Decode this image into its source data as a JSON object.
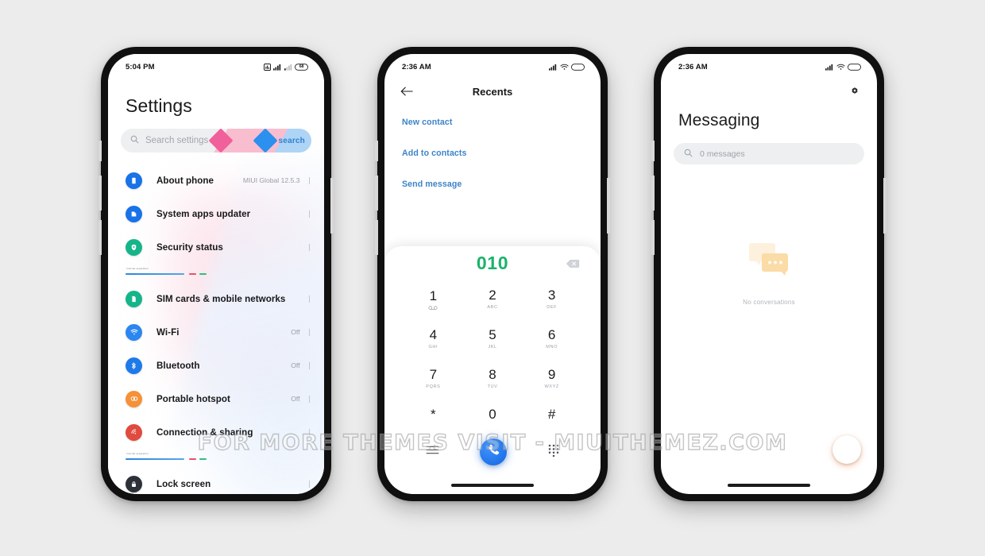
{
  "watermark": "FOR MORE THEMES VISIT - MIUITHEMEZ.COM",
  "phone_settings": {
    "status": {
      "time": "5:04 PM",
      "battery_level": "68"
    },
    "title": "Settings",
    "search": {
      "placeholder": "Search settings",
      "deco_label": "search",
      "icon": "search-icon"
    },
    "divider_label": "Internal separation",
    "items": [
      {
        "label": "About phone",
        "value": "MIUI Global 12.5.3",
        "icon": "phone-info-icon",
        "color": "#1872e8"
      },
      {
        "label": "System apps updater",
        "value": "",
        "icon": "apps-update-icon",
        "color": "#1872e8"
      },
      {
        "label": "Security status",
        "value": "",
        "icon": "shield-check-icon",
        "color": "#15b589"
      },
      {
        "label": "SIM cards & mobile networks",
        "value": "",
        "icon": "sim-card-icon",
        "color": "#15b589"
      },
      {
        "label": "Wi-Fi",
        "value": "Off",
        "icon": "wifi-icon",
        "color": "#2a86f0"
      },
      {
        "label": "Bluetooth",
        "value": "Off",
        "icon": "bluetooth-icon",
        "color": "#1e7ae8"
      },
      {
        "label": "Portable hotspot",
        "value": "Off",
        "icon": "hotspot-icon",
        "color": "#f59137"
      },
      {
        "label": "Connection & sharing",
        "value": "",
        "icon": "share-waves-icon",
        "color": "#e04a3f"
      },
      {
        "label": "Lock screen",
        "value": "",
        "icon": "lock-icon",
        "color": "#2c3038"
      }
    ]
  },
  "phone_dialer": {
    "status": {
      "time": "2:36 AM"
    },
    "title": "Recents",
    "back_icon": "arrow-left-icon",
    "links": [
      {
        "label": "New contact"
      },
      {
        "label": "Add to contacts"
      },
      {
        "label": "Send message"
      }
    ],
    "dialed_number": "010",
    "number_color": "#19b36b",
    "backspace_icon": "backspace-icon",
    "keys": [
      {
        "num": "1",
        "sub": "",
        "vm": true
      },
      {
        "num": "2",
        "sub": "ABC",
        "vm": false
      },
      {
        "num": "3",
        "sub": "DEF",
        "vm": false
      },
      {
        "num": "4",
        "sub": "GHI",
        "vm": false
      },
      {
        "num": "5",
        "sub": "JKL",
        "vm": false
      },
      {
        "num": "6",
        "sub": "MNO",
        "vm": false
      },
      {
        "num": "7",
        "sub": "PQRS",
        "vm": false
      },
      {
        "num": "8",
        "sub": "TUV",
        "vm": false
      },
      {
        "num": "9",
        "sub": "WXYZ",
        "vm": false
      },
      {
        "num": "*",
        "sub": "",
        "vm": false
      },
      {
        "num": "0",
        "sub": "",
        "vm": false
      },
      {
        "num": "#",
        "sub": "",
        "vm": false
      }
    ],
    "bottom_bar": {
      "menu_icon": "list-menu-icon",
      "call_icon": "phone-call-icon",
      "keypad_icon": "dialpad-icon",
      "call_color": "#1565e0"
    }
  },
  "phone_messaging": {
    "status": {
      "time": "2:36 AM"
    },
    "settings_icon": "gear-icon",
    "title": "Messaging",
    "search": {
      "placeholder": "0 messages",
      "icon": "search-icon"
    },
    "empty_state": {
      "illustration": "speech-bubbles-icon",
      "caption": "No conversations"
    },
    "fab": {
      "icon": "plus-icon",
      "color": "#f58b52"
    }
  }
}
